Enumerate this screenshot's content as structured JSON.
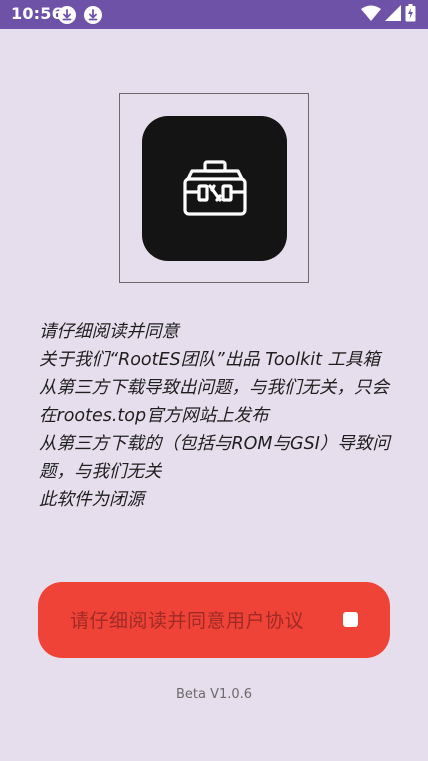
{
  "status_bar": {
    "time": "10:56",
    "notification_icons": [
      "download-icon",
      "download-icon"
    ],
    "system_icons": [
      "wifi-icon",
      "signal-icon",
      "battery-charging-icon"
    ]
  },
  "app": {
    "logo_icon": "toolbox-icon",
    "notice_lines": [
      "请仔细阅读并同意",
      "关于我们“RootES团队”出品 Toolkit 工具箱",
      "从第三方下载导致出问题，与我们无关，只会在rootes.top官方网站上发布",
      "从第三方下载的（包括与ROM与GSI）导致问题，与我们无关",
      "此软件为闭源"
    ],
    "agree_button_label": "请仔细阅读并同意用户协议",
    "version": "Beta V1.0.6"
  },
  "colors": {
    "status_bar": "#6e52a8",
    "background": "#e6deec",
    "button": "#f04337",
    "button_text": "#a02a26"
  }
}
